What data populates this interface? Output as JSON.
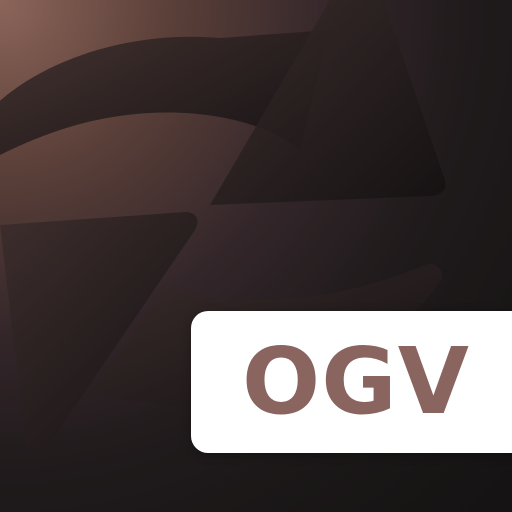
{
  "app_icon": {
    "format_label": "OGV",
    "colors": {
      "background_highlight": "#8c655a",
      "background_dark": "#151313",
      "badge_background": "#ffffff",
      "badge_text": "#8a6560",
      "arrow_fill": "#2a2122"
    },
    "icons": [
      "refresh-arrows-icon"
    ]
  }
}
